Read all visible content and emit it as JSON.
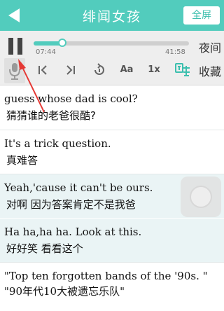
{
  "header": {
    "title": "绯闻女孩",
    "fullscreen_label": "全屏"
  },
  "player": {
    "current_time": "07:44",
    "total_time": "41:58",
    "progress_fraction": 0.185,
    "night_mode_label": "夜间"
  },
  "controls": {
    "font_label": "Aa",
    "speed_label": "1x",
    "bookmark_label": "收藏"
  },
  "subtitles": [
    {
      "en": "guess whose dad is cool?",
      "zh": "猜猜谁的老爸很酷?"
    },
    {
      "en": "It's a trick question.",
      "zh": "真难答"
    },
    {
      "en": "Yeah,'cause it can't be ours.",
      "zh": "对啊 因为答案肯定不是我爸"
    },
    {
      "en": "Ha ha,ha ha. Look at this.",
      "zh": "好好笑 看看这个"
    },
    {
      "en": "\"Top ten forgotten bands of the '90s. \" \"90年代10大被遗忘乐队\"",
      "zh": ""
    }
  ],
  "colors": {
    "accent": "#52ccbd",
    "annotation_arrow": "#e53935"
  }
}
